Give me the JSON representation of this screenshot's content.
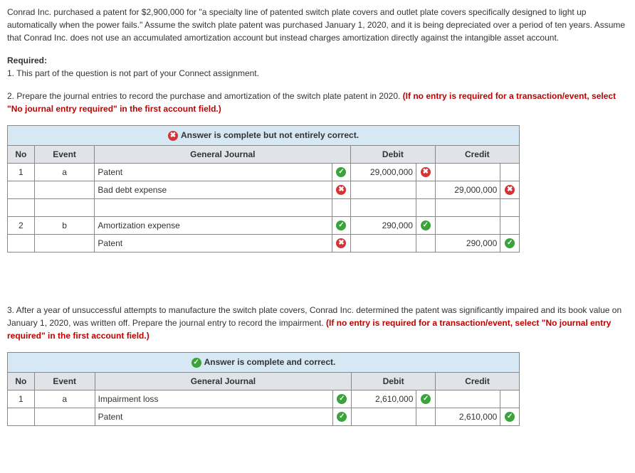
{
  "question": {
    "intro": "Conrad Inc. purchased a patent for $2,900,000 for \"a specialty line of patented switch plate covers and outlet plate covers specifically designed to light up automatically when the power fails.\" Assume the switch plate patent was purchased January 1, 2020, and it is being depreciated over a period of ten years. Assume that Conrad Inc. does not use an accumulated amortization account but instead charges amortization directly against the intangible asset account.",
    "required_label": "Required:",
    "req1": "1. This part of the question is not part of your Connect assignment.",
    "req2_a": "2. Prepare the journal entries to record the purchase and amortization of the switch plate patent in 2020. ",
    "req2_b": "(If no entry is required for a transaction/event, select \"No journal entry required\" in the first account field.)",
    "req3_a": "3. After a year of unsuccessful attempts to manufacture the switch plate covers, Conrad Inc. determined the patent was significantly impaired and its book value on January 1, 2020, was written off. Prepare the journal entry to record the impairment. ",
    "req3_b": "(If no entry is required for a transaction/event, select \"No journal entry required\" in the first account field.)"
  },
  "banner1": "Answer is complete but not entirely correct.",
  "banner2": "Answer is complete and correct.",
  "headers": {
    "no": "No",
    "event": "Event",
    "gj": "General Journal",
    "debit": "Debit",
    "credit": "Credit"
  },
  "table1": {
    "rows": [
      {
        "no": "1",
        "event": "a",
        "account": "Patent",
        "indent": false,
        "mark": "correct",
        "debit": "29,000,000",
        "debit_mark": "wrong",
        "credit": "",
        "credit_mark": ""
      },
      {
        "no": "",
        "event": "",
        "account": "Bad debt expense",
        "indent": true,
        "mark": "wrong",
        "debit": "",
        "debit_mark": "",
        "credit": "29,000,000",
        "credit_mark": "wrong"
      },
      {
        "no": "",
        "event": "",
        "account": "",
        "indent": false,
        "mark": "",
        "debit": "",
        "debit_mark": "",
        "credit": "",
        "credit_mark": ""
      },
      {
        "no": "2",
        "event": "b",
        "account": "Amortization expense",
        "indent": false,
        "mark": "correct",
        "debit": "290,000",
        "debit_mark": "correct",
        "credit": "",
        "credit_mark": ""
      },
      {
        "no": "",
        "event": "",
        "account": "Patent",
        "indent": true,
        "mark": "wrong",
        "debit": "",
        "debit_mark": "",
        "credit": "290,000",
        "credit_mark": "correct"
      }
    ]
  },
  "table2": {
    "rows": [
      {
        "no": "1",
        "event": "a",
        "account": "Impairment loss",
        "indent": false,
        "mark": "correct",
        "debit": "2,610,000",
        "debit_mark": "correct",
        "credit": "",
        "credit_mark": ""
      },
      {
        "no": "",
        "event": "",
        "account": "Patent",
        "indent": true,
        "mark": "correct",
        "debit": "",
        "debit_mark": "",
        "credit": "2,610,000",
        "credit_mark": "correct"
      }
    ]
  }
}
